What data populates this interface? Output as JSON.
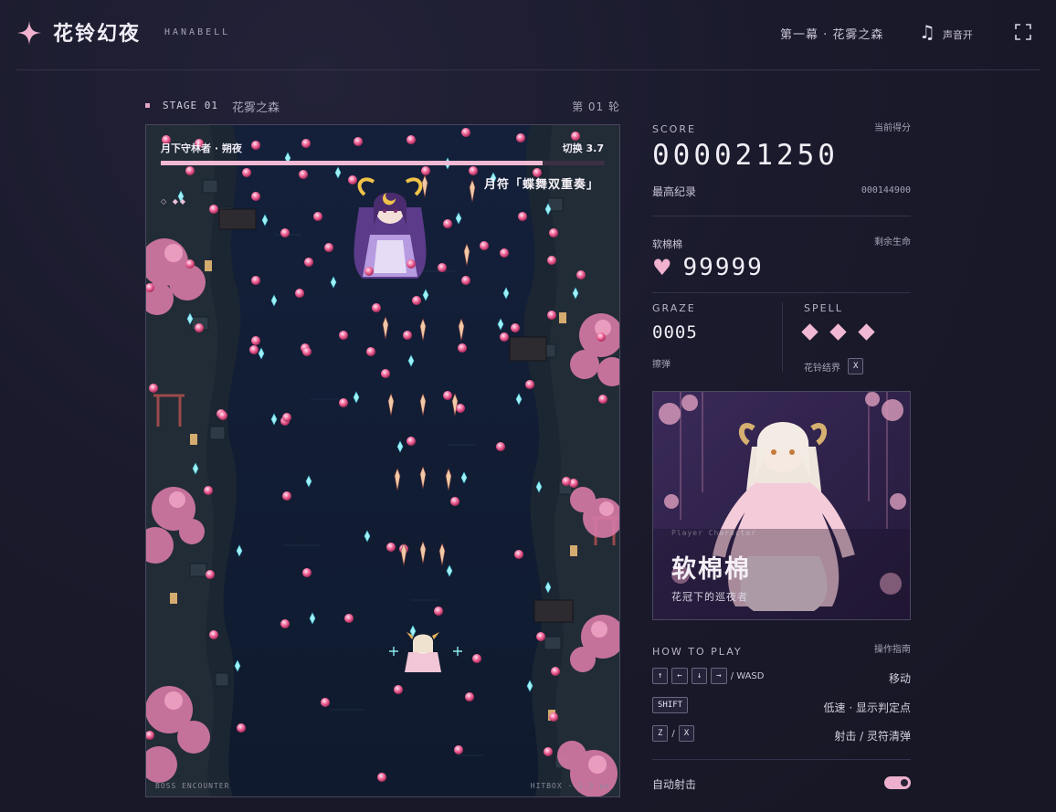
{
  "header": {
    "title": "花铃幻夜",
    "subtitle": "HANABELL",
    "stage_label": "第一幕 · 花雾之森",
    "sound_label": "声音开",
    "icons": {
      "logo": "sparkle-icon",
      "sound": "music-note-icon",
      "fullscreen": "fullscreen-icon"
    }
  },
  "stage_bar": {
    "code": "STAGE 01",
    "name": "花雾之森",
    "round": "第 01 轮"
  },
  "field": {
    "boss_name": "月下守林者 · 朔夜",
    "timer": "切换 3.7",
    "boss_hp_fraction": 0.86,
    "spell_card": "月符「蝶舞双重奏」",
    "life_pips": "◇ ◆◆",
    "footer_left": "BOSS ENCOUNTER",
    "footer_right": "HITBOX · 2.5 px"
  },
  "panel": {
    "score": {
      "label": "SCORE",
      "label_cn": "当前得分",
      "value": "000021250"
    },
    "hiscore": {
      "label": "最高纪录",
      "value": "000144900"
    },
    "lives": {
      "label": "软棉棉",
      "label_right": "剩余生命",
      "value": "99999"
    },
    "graze": {
      "label": "GRAZE",
      "value": "0005",
      "label_cn": "擦弹"
    },
    "spell": {
      "label": "SPELL",
      "count": 3,
      "label_cn": "花铃结界",
      "key": "X"
    },
    "portrait": {
      "caption": "Player Character",
      "name": "软棉棉",
      "tagline": "花冠下的巡夜者"
    },
    "howto": {
      "label": "HOW TO PLAY",
      "label_cn": "操作指南",
      "move_keys": [
        "↑",
        "←",
        "↓",
        "→"
      ],
      "move_alt": "/ WASD",
      "move_action": "移动",
      "slow_key": "SHIFT",
      "slow_action": "低速 · 显示判定点",
      "shoot_keys": [
        "Z",
        "X"
      ],
      "shoot_sep": "/",
      "shoot_action": "射击 / 灵符清弹"
    },
    "auto_fire": {
      "label": "自动射击",
      "on": true
    },
    "colors": {
      "accent": "#f0b2cf",
      "text": "#f1eef6",
      "muted": "#a6a2b6"
    }
  }
}
